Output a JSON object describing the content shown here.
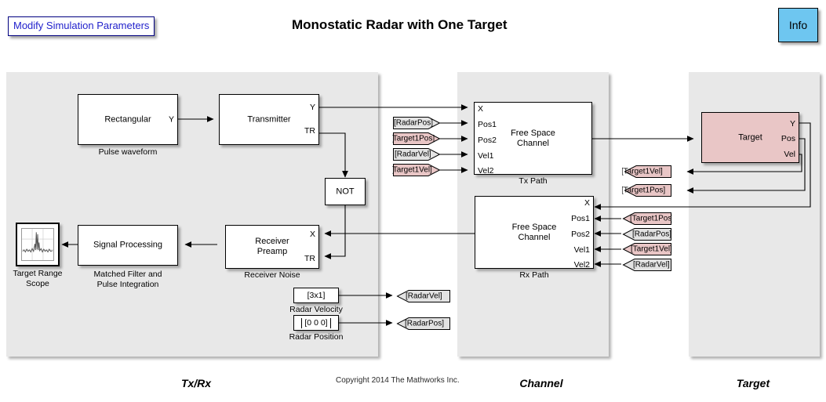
{
  "page": {
    "title": "Monostatic Radar with One Target",
    "copyright": "Copyright 2014 The Mathworks Inc.",
    "modify_button": "Modify Simulation Parameters",
    "info_button": "Info",
    "accent_link": "#2222cc",
    "info_color": "#6EC6F0",
    "target_color": "#E9C6C6",
    "panel_color": "#E8E8E8"
  },
  "panels": [
    {
      "label": "Tx/Rx"
    },
    {
      "label": "Channel"
    },
    {
      "label": "Target"
    }
  ],
  "blocks": {
    "pulse_waveform": {
      "title": "Rectangular",
      "caption": "Pulse waveform",
      "ports_out": [
        "Y"
      ]
    },
    "transmitter": {
      "title": "Transmitter",
      "caption": "",
      "ports_out": [
        "Y",
        "TR"
      ]
    },
    "not_gate": {
      "title": "NOT",
      "caption": ""
    },
    "signal_processing": {
      "title": "Signal Processing",
      "caption": "Matched Filter and\nPulse Integration"
    },
    "receiver_preamp": {
      "title": "Receiver\nPreamp",
      "caption": "Receiver Noise",
      "ports_in": [
        "X",
        "TR"
      ]
    },
    "scope": {
      "caption": "Target Range\nScope"
    },
    "tx_path": {
      "title": "Free Space\nChannel",
      "caption": "Tx Path",
      "ports_in": [
        "X",
        "Pos1",
        "Pos2",
        "Vel1",
        "Vel2"
      ]
    },
    "rx_path": {
      "title": "Free Space\nChannel",
      "caption": "Rx Path",
      "ports_in": [
        "X",
        "Pos1",
        "Pos2",
        "Vel1",
        "Vel2"
      ]
    },
    "target": {
      "title": "Target",
      "caption": "",
      "ports_out": [
        "Y",
        "Pos",
        "Vel"
      ]
    },
    "radar_velocity": {
      "value": "[3x1]",
      "caption": "Radar Velocity"
    },
    "radar_position": {
      "value": "[0  0  0]",
      "caption": "Radar Position"
    }
  },
  "tags": {
    "tx_from": [
      {
        "label": "[RadarPos]",
        "kind": "from",
        "color": "gray"
      },
      {
        "label": "[Target1Pos]",
        "kind": "from",
        "color": "pink"
      },
      {
        "label": "[RadarVel]",
        "kind": "from",
        "color": "gray"
      },
      {
        "label": "[Target1Vel]",
        "kind": "from",
        "color": "pink"
      }
    ],
    "rx_from": [
      {
        "label": "[Target1Pos]",
        "kind": "from",
        "color": "pink"
      },
      {
        "label": "[RadarPos]",
        "kind": "from",
        "color": "gray"
      },
      {
        "label": "[Target1Vel]",
        "kind": "from",
        "color": "pink"
      },
      {
        "label": "[RadarVel]",
        "kind": "from",
        "color": "gray"
      }
    ],
    "target_goto": [
      {
        "label": "[Target1Vel]",
        "kind": "goto",
        "color": "pink"
      },
      {
        "label": "[Target1Pos]",
        "kind": "goto",
        "color": "pink"
      }
    ],
    "radar_goto": [
      {
        "label": "[RadarVel]",
        "kind": "goto",
        "color": "gray"
      },
      {
        "label": "[RadarPos]",
        "kind": "goto",
        "color": "gray"
      }
    ]
  }
}
